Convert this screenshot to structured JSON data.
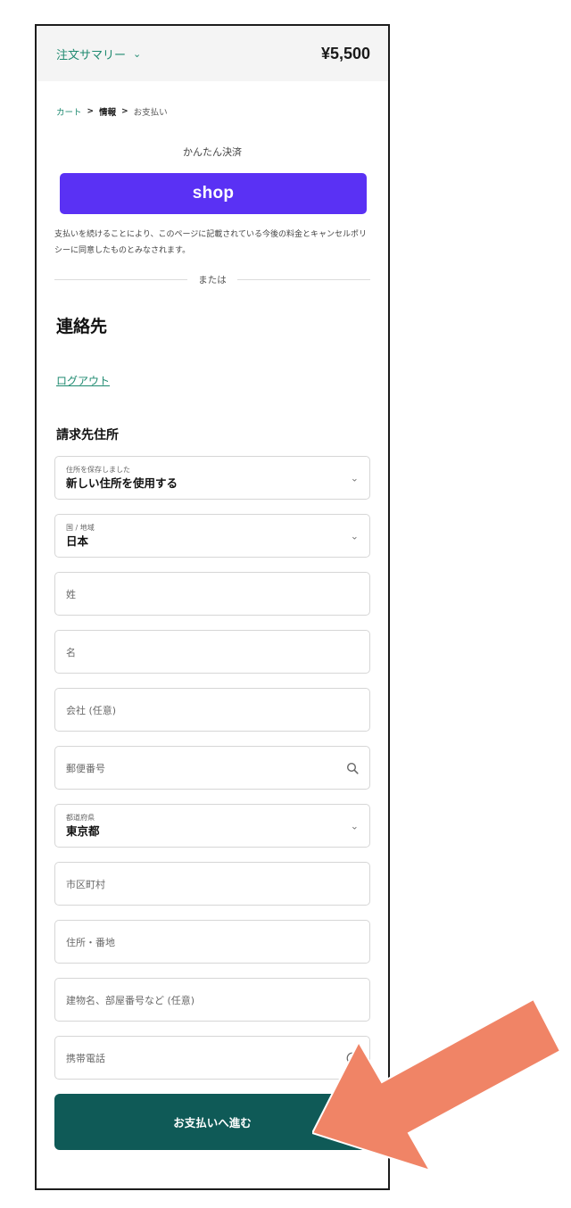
{
  "summary": {
    "toggle_label": "注文サマリー",
    "total": "¥5,500"
  },
  "breadcrumb": {
    "cart": "カート",
    "info": "情報",
    "payment": "お支払い",
    "separator": ">"
  },
  "express": {
    "title": "かんたん決済",
    "shop_label": "shop"
  },
  "notice": "支払いを続けることにより、このページに記載されている今後の料金とキャンセルポリシーに同意したものとみなされます。",
  "divider_label": "または",
  "contact": {
    "title": "連絡先",
    "logout_label": "ログアウト"
  },
  "billing": {
    "title": "請求先住所",
    "saved_address": {
      "label": "住所を保存しました",
      "value": "新しい住所を使用する"
    },
    "country": {
      "label": "国 / 地域",
      "value": "日本"
    },
    "last_name_placeholder": "姓",
    "first_name_placeholder": "名",
    "company_placeholder": "会社 (任意)",
    "postal_placeholder": "郵便番号",
    "prefecture": {
      "label": "都道府県",
      "value": "東京都"
    },
    "city_placeholder": "市区町村",
    "address_placeholder": "住所・番地",
    "building_placeholder": "建物名、部屋番号など (任意)",
    "phone_placeholder": "携帯電話"
  },
  "continue_label": "お支払いへ進む",
  "colors": {
    "shop_purple": "#5a31f4",
    "primary_teal": "#0f5a57",
    "link_green": "#1f8a70",
    "annotation_arrow": "#f08466"
  },
  "icons": {
    "summary_toggle": "chevron-down-icon",
    "select_indicator": "chevron-down-icon",
    "postal_lookup": "search-icon",
    "phone_help": "help-icon",
    "annotation": "arrow-annotation"
  }
}
